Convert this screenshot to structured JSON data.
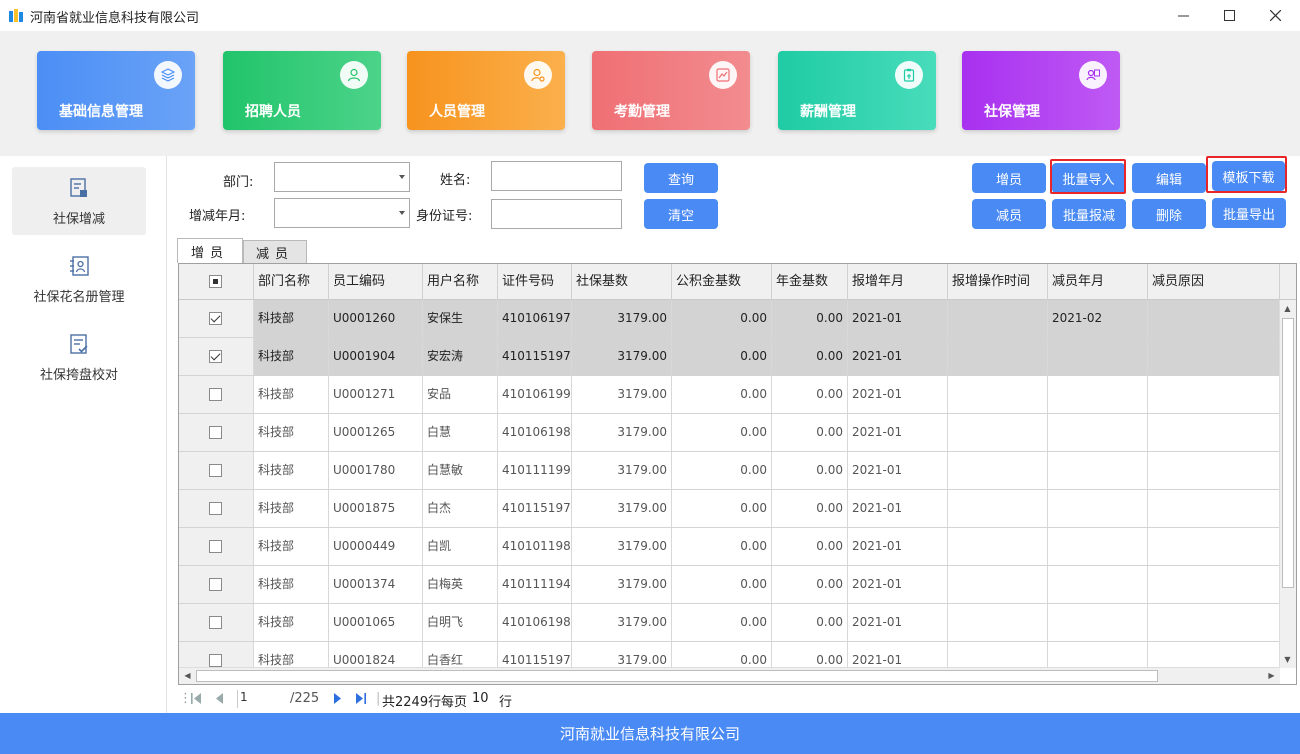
{
  "window": {
    "title": "河南省就业信息科技有限公司",
    "minimize": "—",
    "maximize": "☐",
    "close": "✕"
  },
  "modules": [
    {
      "label": "基础信息管理",
      "icon": "layers-icon",
      "color_from": "#4b8ef5",
      "color_to": "#6aa3f7"
    },
    {
      "label": "招聘人员",
      "icon": "person-icon",
      "color_from": "#21c46a",
      "color_to": "#4cd38a"
    },
    {
      "label": "人员管理",
      "icon": "user-gear-icon",
      "color_from": "#f7931e",
      "color_to": "#fbb04c"
    },
    {
      "label": "考勤管理",
      "icon": "chart-icon",
      "color_from": "#ef6f74",
      "color_to": "#f28c8f"
    },
    {
      "label": "薪酬管理",
      "icon": "clipboard-icon",
      "color_from": "#1fcca4",
      "color_to": "#48dcbb"
    },
    {
      "label": "社保管理",
      "icon": "id-card-icon",
      "color_from": "#a830f0",
      "color_to": "#bf5af4"
    }
  ],
  "sidebar": {
    "items": [
      {
        "label": "社保增减"
      },
      {
        "label": "社保花名册管理"
      },
      {
        "label": "社保挎盘校对"
      }
    ]
  },
  "filters": {
    "dept_label": "部门:",
    "name_label": "姓名:",
    "month_label": "增减年月:",
    "idcard_label": "身份证号:",
    "dept_value": "",
    "name_value": "",
    "month_value": "",
    "idcard_value": ""
  },
  "buttons": {
    "query": "查询",
    "clear": "清空",
    "add": "增员",
    "batch_import": "批量导入",
    "edit": "编辑",
    "template_download": "模板下载",
    "reduce": "减员",
    "batch_reduce": "批量报减",
    "delete": "删除",
    "batch_export": "批量导出"
  },
  "tabs": [
    "增员",
    "减员"
  ],
  "table": {
    "columns": [
      "部门名称",
      "员工编码",
      "用户名称",
      "证件号码",
      "社保基数",
      "公积金基数",
      "年金基数",
      "报增年月",
      "报增操作时间",
      "减员年月",
      "减员原因"
    ],
    "rows": [
      {
        "checked": true,
        "selected": true,
        "cells": [
          "科技部",
          "U0001260",
          "安保生",
          "410106197...",
          "3179.00",
          "0.00",
          "0.00",
          "2021-01",
          "",
          "2021-02",
          ""
        ]
      },
      {
        "checked": true,
        "selected": true,
        "cells": [
          "科技部",
          "U0001904",
          "安宏涛",
          "410115197...",
          "3179.00",
          "0.00",
          "0.00",
          "2021-01",
          "",
          "",
          ""
        ]
      },
      {
        "checked": false,
        "selected": false,
        "cells": [
          "科技部",
          "U0001271",
          "安品",
          "410106199...",
          "3179.00",
          "0.00",
          "0.00",
          "2021-01",
          "",
          "",
          ""
        ]
      },
      {
        "checked": false,
        "selected": false,
        "cells": [
          "科技部",
          "U0001265",
          "白慧",
          "410106198...",
          "3179.00",
          "0.00",
          "0.00",
          "2021-01",
          "",
          "",
          ""
        ]
      },
      {
        "checked": false,
        "selected": false,
        "cells": [
          "科技部",
          "U0001780",
          "白慧敏",
          "410111199...",
          "3179.00",
          "0.00",
          "0.00",
          "2021-01",
          "",
          "",
          ""
        ]
      },
      {
        "checked": false,
        "selected": false,
        "cells": [
          "科技部",
          "U0001875",
          "白杰",
          "410115197...",
          "3179.00",
          "0.00",
          "0.00",
          "2021-01",
          "",
          "",
          ""
        ]
      },
      {
        "checked": false,
        "selected": false,
        "cells": [
          "科技部",
          "U0000449",
          "白凯",
          "410101198...",
          "3179.00",
          "0.00",
          "0.00",
          "2021-01",
          "",
          "",
          ""
        ]
      },
      {
        "checked": false,
        "selected": false,
        "cells": [
          "科技部",
          "U0001374",
          "白梅英",
          "410111194...",
          "3179.00",
          "0.00",
          "0.00",
          "2021-01",
          "",
          "",
          ""
        ]
      },
      {
        "checked": false,
        "selected": false,
        "cells": [
          "科技部",
          "U0001065",
          "白明飞",
          "410106198...",
          "3179.00",
          "0.00",
          "0.00",
          "2021-01",
          "",
          "",
          ""
        ]
      },
      {
        "checked": false,
        "selected": false,
        "cells": [
          "科技部",
          "U0001824",
          "白香红",
          "410115197...",
          "3179.00",
          "0.00",
          "0.00",
          "2021-01",
          "",
          "",
          ""
        ]
      }
    ]
  },
  "pager": {
    "current_page": "1",
    "total_pages": "/225",
    "total_rows": "共2249行",
    "per_page_label": "每页",
    "per_page": "10",
    "rows_unit": "行"
  },
  "footer": {
    "text": "河南就业信息科技有限公司"
  },
  "colors": {
    "accent": "#4a8af4",
    "highlight_border": "#e8262a"
  }
}
